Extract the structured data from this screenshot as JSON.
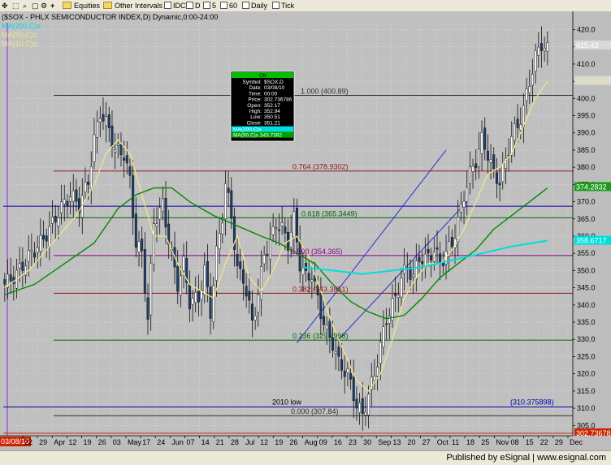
{
  "toolbar": {
    "equities": "Equities",
    "intervals": "Other Intervals",
    "idc": "IDC",
    "d": "D",
    "i5": "5",
    "i60": "60",
    "daily": "Daily",
    "tick": "Tick"
  },
  "status": {
    "published": "Published by eSignal | www.esignal.com"
  },
  "colors": {
    "background": "#c0c0c0",
    "candle_up": "#ffffff",
    "candle_down": "#1a3f6e",
    "ma50_close": "#008800",
    "ma50_cyan": "#00dddd",
    "ma10": "#f0e68c"
  },
  "chart_data": {
    "type": "candlestick",
    "title": "($SOX - PHLX SEMICONDUCTOR INDEX,D) Dynamic,0:00-24:00",
    "legend": [
      {
        "text": "MA(200,C)s",
        "color": "#00dddd"
      },
      {
        "text": "MA(50,C)s",
        "color": "#f0e68c"
      },
      {
        "text": "MA(10,C)s",
        "color": "#f0e68c"
      }
    ],
    "y_axis": {
      "min": 302,
      "max": 422,
      "ticks": [
        305,
        310,
        315,
        320,
        325,
        330,
        335,
        340,
        345,
        350,
        355,
        360,
        365,
        370,
        375,
        380,
        385,
        390,
        395,
        400,
        405,
        410,
        415,
        420
      ]
    },
    "x_ticks": [
      "22",
      "29",
      "Apr",
      "12",
      "19",
      "26",
      "03",
      "May",
      "17",
      "24",
      "Jun",
      "07",
      "14",
      "21",
      "28",
      "Jul",
      "12",
      "19",
      "26",
      "Aug",
      "09",
      "16",
      "23",
      "30",
      "Sep",
      "13",
      "20",
      "27",
      "Oct",
      "11",
      "18",
      "25",
      "Nov",
      "08",
      "15",
      "22",
      "29",
      "Dec"
    ],
    "start_label": "03/08/10",
    "price_badges": [
      {
        "label": "415.43",
        "value": 415.43,
        "bg": "#d9d9d9",
        "fg": "#ffffff"
      },
      {
        "label": "405.120088",
        "value": 405.12,
        "bg": "#d9d9d9",
        "fg": "#f0e68c"
      },
      {
        "label": "374.2832",
        "value": 374.28,
        "bg": "#1f9a1f",
        "fg": "#ffffff"
      },
      {
        "label": "358.6717",
        "value": 358.67,
        "bg": "#00dddd",
        "fg": "#ffffff"
      },
      {
        "label": "302.736786",
        "value": 302.74,
        "bg": "#cc2200",
        "fg": "#ffffff"
      }
    ],
    "fib_levels": [
      {
        "label": "1.000 (400.89)",
        "value": 400.89,
        "color": "#333333"
      },
      {
        "label": "0.764 (378.9302)",
        "value": 378.93,
        "color": "#8b1a1a"
      },
      {
        "label": "0.618 (365.3449)",
        "value": 365.34,
        "color": "#006400"
      },
      {
        "label": "0.500 (354.365)",
        "value": 354.37,
        "color": "#8b008b"
      },
      {
        "label": "0.382 (343.3851)",
        "value": 343.39,
        "color": "#8b1a1a"
      },
      {
        "label": "0.236 (329.7998)",
        "value": 329.8,
        "color": "#006400"
      },
      {
        "label": "0.000 (307.84)",
        "value": 307.84,
        "color": "#333333"
      }
    ],
    "horizontal_lines": [
      {
        "label": "2010 low",
        "value": 310.38,
        "color": "#0000aa"
      },
      {
        "label": "(310.375898)",
        "value": 310.38,
        "color": "#0000aa"
      },
      {
        "value": 368.7,
        "color": "#0000aa"
      },
      {
        "value": 302.74,
        "color": "#cc2200"
      }
    ],
    "trendlines": [
      {
        "from": [
          98,
          329
        ],
        "to": [
          148,
          385
        ]
      },
      {
        "from": [
          112,
          330
        ],
        "to": [
          155,
          370
        ]
      }
    ],
    "data_window": {
      "header": "OK",
      "rows": [
        [
          "Symbol",
          "$SOX,D"
        ],
        [
          "Date",
          "03/08/10"
        ],
        [
          "Time",
          "00:00"
        ],
        [
          "Price",
          "302.736786"
        ],
        [
          "Open",
          "352.17"
        ],
        [
          "High",
          "352.94"
        ],
        [
          "Low",
          "350.51"
        ],
        [
          "Close",
          "351.21"
        ]
      ],
      "ma_rows": [
        [
          "MA(200,C)s",
          ""
        ],
        [
          "MA(50,C)s",
          "343.7392"
        ]
      ]
    },
    "x_bars": 191,
    "ohlc_close_path": [
      [
        0,
        346
      ],
      [
        4,
        349
      ],
      [
        8,
        354
      ],
      [
        12,
        358
      ],
      [
        15,
        362
      ],
      [
        18,
        367
      ],
      [
        22,
        372
      ],
      [
        25,
        369
      ],
      [
        28,
        376
      ],
      [
        30,
        388
      ],
      [
        32,
        396
      ],
      [
        35,
        391
      ],
      [
        37,
        385
      ],
      [
        40,
        384
      ],
      [
        42,
        376
      ],
      [
        44,
        358
      ],
      [
        46,
        355
      ],
      [
        48,
        336
      ],
      [
        50,
        364
      ],
      [
        53,
        369
      ],
      [
        56,
        354
      ],
      [
        58,
        346
      ],
      [
        60,
        352
      ],
      [
        62,
        341
      ],
      [
        65,
        342
      ],
      [
        67,
        350
      ],
      [
        69,
        338
      ],
      [
        71,
        355
      ],
      [
        73,
        366
      ],
      [
        74,
        375
      ],
      [
        76,
        366
      ],
      [
        78,
        350
      ],
      [
        80,
        348
      ],
      [
        83,
        335
      ],
      [
        85,
        343
      ],
      [
        87,
        355
      ],
      [
        89,
        358
      ],
      [
        91,
        364
      ],
      [
        93,
        362
      ],
      [
        95,
        358
      ],
      [
        97,
        365
      ],
      [
        99,
        352
      ],
      [
        101,
        348
      ],
      [
        103,
        349
      ],
      [
        106,
        338
      ],
      [
        108,
        332
      ],
      [
        110,
        329
      ],
      [
        112,
        323
      ],
      [
        115,
        320
      ],
      [
        118,
        311
      ],
      [
        120,
        308
      ],
      [
        122,
        314
      ],
      [
        124,
        320
      ],
      [
        126,
        328
      ],
      [
        128,
        336
      ],
      [
        131,
        342
      ],
      [
        133,
        348
      ],
      [
        135,
        351
      ],
      [
        137,
        348
      ],
      [
        139,
        354
      ],
      [
        141,
        353
      ],
      [
        144,
        356
      ],
      [
        146,
        352
      ],
      [
        148,
        355
      ],
      [
        150,
        358
      ],
      [
        152,
        364
      ],
      [
        154,
        372
      ],
      [
        156,
        378
      ],
      [
        158,
        382
      ],
      [
        160,
        388
      ],
      [
        162,
        384
      ],
      [
        164,
        378
      ],
      [
        166,
        376
      ],
      [
        168,
        382
      ],
      [
        170,
        389
      ],
      [
        172,
        392
      ],
      [
        174,
        397
      ],
      [
        176,
        405
      ],
      [
        178,
        412
      ],
      [
        180,
        416
      ],
      [
        182,
        414
      ]
    ],
    "ma10_path": [
      [
        0,
        345
      ],
      [
        8,
        350
      ],
      [
        16,
        358
      ],
      [
        24,
        366
      ],
      [
        30,
        375
      ],
      [
        34,
        384
      ],
      [
        38,
        388
      ],
      [
        42,
        384
      ],
      [
        46,
        372
      ],
      [
        50,
        360
      ],
      [
        54,
        360
      ],
      [
        58,
        352
      ],
      [
        62,
        346
      ],
      [
        66,
        344
      ],
      [
        70,
        342
      ],
      [
        74,
        352
      ],
      [
        78,
        360
      ],
      [
        82,
        348
      ],
      [
        86,
        344
      ],
      [
        90,
        350
      ],
      [
        94,
        358
      ],
      [
        98,
        360
      ],
      [
        102,
        354
      ],
      [
        106,
        344
      ],
      [
        110,
        334
      ],
      [
        114,
        326
      ],
      [
        118,
        318
      ],
      [
        122,
        315
      ],
      [
        126,
        320
      ],
      [
        130,
        330
      ],
      [
        134,
        342
      ],
      [
        138,
        348
      ],
      [
        142,
        352
      ],
      [
        146,
        352
      ],
      [
        150,
        356
      ],
      [
        154,
        362
      ],
      [
        158,
        370
      ],
      [
        162,
        378
      ],
      [
        166,
        380
      ],
      [
        170,
        384
      ],
      [
        174,
        392
      ],
      [
        178,
        400
      ],
      [
        182,
        405
      ]
    ],
    "ma50_path": [
      [
        0,
        343
      ],
      [
        10,
        346
      ],
      [
        20,
        352
      ],
      [
        30,
        358
      ],
      [
        38,
        368
      ],
      [
        44,
        372
      ],
      [
        50,
        374
      ],
      [
        56,
        374
      ],
      [
        62,
        370
      ],
      [
        70,
        366
      ],
      [
        78,
        363
      ],
      [
        86,
        360
      ],
      [
        92,
        358
      ],
      [
        98,
        355
      ],
      [
        104,
        352
      ],
      [
        110,
        346
      ],
      [
        116,
        341
      ],
      [
        122,
        338
      ],
      [
        128,
        336
      ],
      [
        134,
        337
      ],
      [
        140,
        342
      ],
      [
        146,
        348
      ],
      [
        152,
        352
      ],
      [
        158,
        356
      ],
      [
        164,
        362
      ],
      [
        170,
        366
      ],
      [
        176,
        370
      ],
      [
        182,
        374
      ]
    ],
    "ma200_path": [
      [
        100,
        351
      ],
      [
        110,
        350
      ],
      [
        120,
        349
      ],
      [
        130,
        350
      ],
      [
        140,
        351
      ],
      [
        150,
        353
      ],
      [
        160,
        355
      ],
      [
        170,
        357
      ],
      [
        182,
        358.7
      ]
    ]
  }
}
